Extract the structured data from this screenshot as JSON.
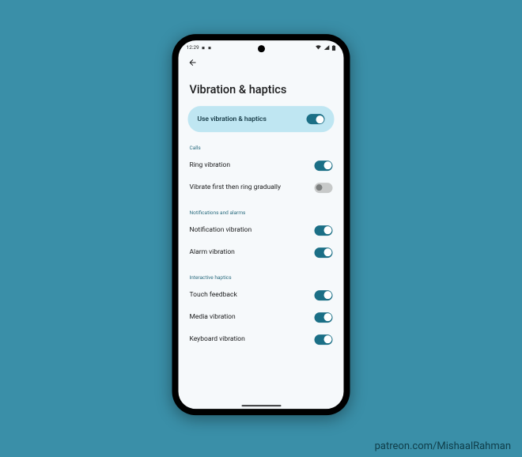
{
  "status": {
    "time": "12:29",
    "extra_indicator": "•"
  },
  "page": {
    "title": "Vibration & haptics"
  },
  "master": {
    "label": "Use vibration & haptics",
    "on": true
  },
  "sections": {
    "calls": {
      "header": "Calls",
      "items": {
        "ring": {
          "label": "Ring vibration",
          "on": true
        },
        "vibrate_first": {
          "label": "Vibrate first then ring gradually",
          "on": false
        }
      }
    },
    "notifications": {
      "header": "Notifications and alarms",
      "items": {
        "notification": {
          "label": "Notification vibration",
          "on": true
        },
        "alarm": {
          "label": "Alarm vibration",
          "on": true
        }
      }
    },
    "interactive": {
      "header": "Interactive haptics",
      "items": {
        "touch": {
          "label": "Touch feedback",
          "on": true
        },
        "media": {
          "label": "Media vibration",
          "on": true
        },
        "keyboard": {
          "label": "Keyboard vibration",
          "on": true
        }
      }
    }
  },
  "attribution": "patreon.com/MishaalRahman"
}
